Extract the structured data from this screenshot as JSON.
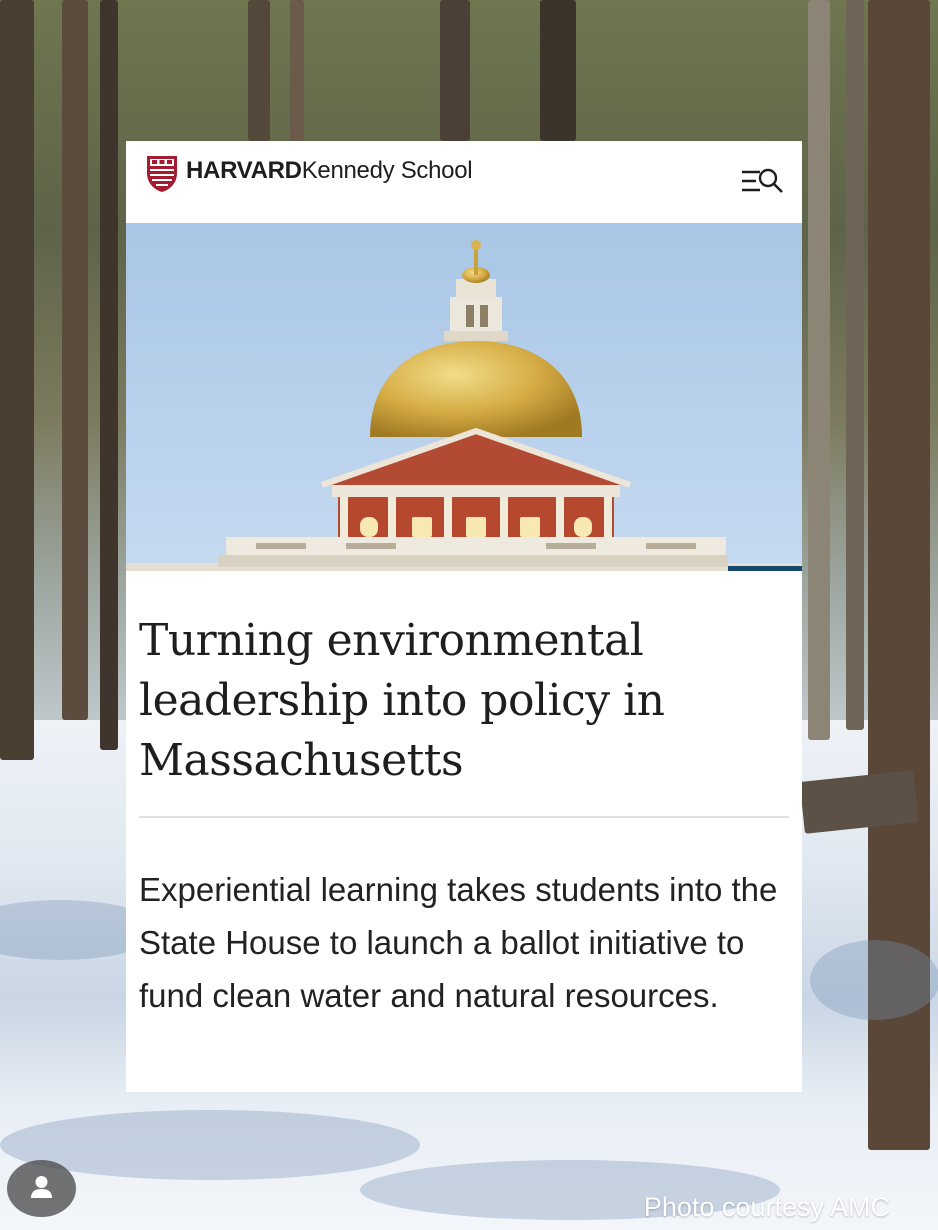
{
  "header": {
    "brand_bold": "HARVARD",
    "brand_regular": "Kennedy School",
    "menu_icon": "menu-search-icon"
  },
  "hero": {
    "image": "massachusetts-state-house-photo",
    "carousel_icon": "chevron-left-icon"
  },
  "article": {
    "headline": "Turning environmental leadership into policy in Massachusetts",
    "summary": "Experiential learning takes students into the State House to launch a ballot initiative to fund clean water and natural resources."
  },
  "overlay": {
    "credit": "Photo courtesy AMC",
    "avatar_icon": "user-avatar-icon"
  },
  "colors": {
    "accent": "#164a6d",
    "crimson": "#a51c30",
    "text": "#1e1e1e",
    "card": "#ffffff"
  }
}
